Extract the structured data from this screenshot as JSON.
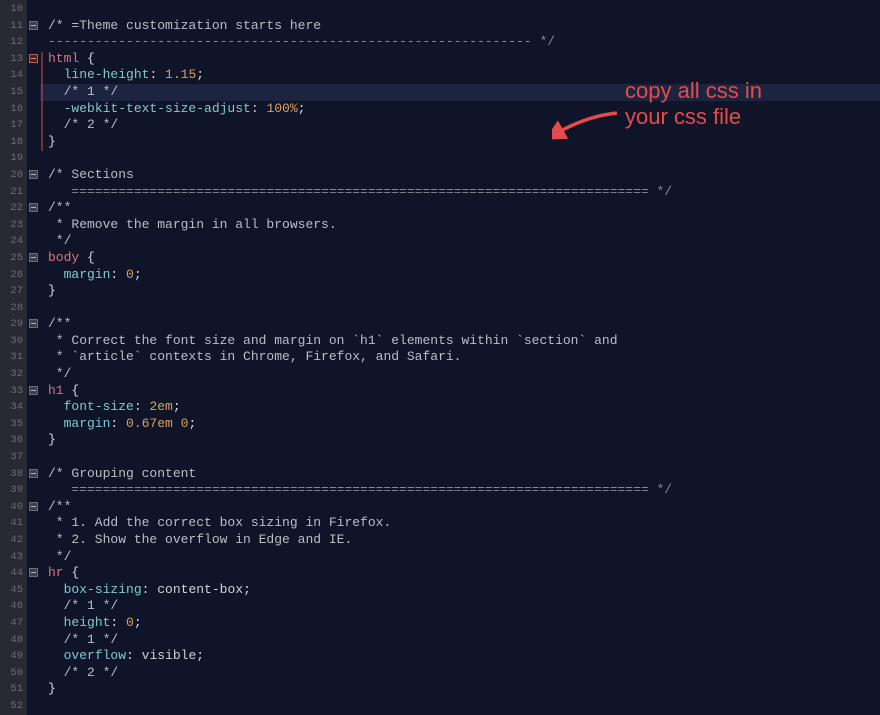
{
  "annotation": {
    "line1": "copy all css in",
    "line2": "your css file"
  },
  "lines": [
    {
      "n": 10
    },
    {
      "n": 11,
      "fold": true,
      "tokens": [
        [
          "comment",
          "/* =Theme customization starts here"
        ]
      ]
    },
    {
      "n": 12,
      "tokens": [
        [
          "faint",
          "-------------------------------------------------------------- */"
        ]
      ]
    },
    {
      "n": 13,
      "fold": "red",
      "tokens": [
        [
          "selector",
          "html"
        ],
        [
          "punct",
          " "
        ],
        [
          "brace",
          "{"
        ]
      ]
    },
    {
      "n": 14,
      "tokens": [
        [
          "pad",
          "  "
        ],
        [
          "prop",
          "line-height"
        ],
        [
          "punct",
          ": "
        ],
        [
          "num",
          "1.15"
        ],
        [
          "punct",
          ";"
        ]
      ]
    },
    {
      "n": 15,
      "hl": true,
      "tokens": [
        [
          "pad",
          "  "
        ],
        [
          "comment",
          "/* 1 */"
        ]
      ]
    },
    {
      "n": 16,
      "tokens": [
        [
          "pad",
          "  "
        ],
        [
          "prop",
          "-webkit-text-size-adjust"
        ],
        [
          "punct",
          ": "
        ],
        [
          "num",
          "100%"
        ],
        [
          "punct",
          ";"
        ]
      ]
    },
    {
      "n": 17,
      "tokens": [
        [
          "pad",
          "  "
        ],
        [
          "comment",
          "/* 2 */"
        ]
      ]
    },
    {
      "n": 18,
      "tokens": [
        [
          "brace",
          "}"
        ]
      ]
    },
    {
      "n": 19
    },
    {
      "n": 20,
      "fold": true,
      "tokens": [
        [
          "comment",
          "/* Sections"
        ]
      ]
    },
    {
      "n": 21,
      "tokens": [
        [
          "pad",
          "   "
        ],
        [
          "faint",
          "========================================================================== */"
        ]
      ]
    },
    {
      "n": 22,
      "fold": true,
      "tokens": [
        [
          "comment",
          "/**"
        ]
      ]
    },
    {
      "n": 23,
      "tokens": [
        [
          "comment",
          " * Remove the margin in all browsers."
        ]
      ]
    },
    {
      "n": 24,
      "tokens": [
        [
          "comment",
          " */"
        ]
      ]
    },
    {
      "n": 25,
      "fold": true,
      "tokens": [
        [
          "selector",
          "body"
        ],
        [
          "punct",
          " "
        ],
        [
          "brace",
          "{"
        ]
      ]
    },
    {
      "n": 26,
      "tokens": [
        [
          "pad",
          "  "
        ],
        [
          "prop",
          "margin"
        ],
        [
          "punct",
          ": "
        ],
        [
          "num",
          "0"
        ],
        [
          "punct",
          ";"
        ]
      ]
    },
    {
      "n": 27,
      "tokens": [
        [
          "brace",
          "}"
        ]
      ]
    },
    {
      "n": 28
    },
    {
      "n": 29,
      "fold": true,
      "tokens": [
        [
          "comment",
          "/**"
        ]
      ]
    },
    {
      "n": 30,
      "tokens": [
        [
          "comment",
          " * Correct the font size and margin on `h1` elements within `section` and"
        ]
      ]
    },
    {
      "n": 31,
      "tokens": [
        [
          "comment",
          " * `article` contexts in Chrome, Firefox, and Safari."
        ]
      ]
    },
    {
      "n": 32,
      "tokens": [
        [
          "comment",
          " */"
        ]
      ]
    },
    {
      "n": 33,
      "fold": true,
      "tokens": [
        [
          "selector",
          "h1"
        ],
        [
          "punct",
          " "
        ],
        [
          "brace",
          "{"
        ]
      ]
    },
    {
      "n": 34,
      "tokens": [
        [
          "pad",
          "  "
        ],
        [
          "prop",
          "font-size"
        ],
        [
          "punct",
          ": "
        ],
        [
          "num",
          "2em"
        ],
        [
          "punct",
          ";"
        ]
      ]
    },
    {
      "n": 35,
      "tokens": [
        [
          "pad",
          "  "
        ],
        [
          "prop",
          "margin"
        ],
        [
          "punct",
          ": "
        ],
        [
          "num",
          "0.67em 0"
        ],
        [
          "punct",
          ";"
        ]
      ]
    },
    {
      "n": 36,
      "tokens": [
        [
          "brace",
          "}"
        ]
      ]
    },
    {
      "n": 37
    },
    {
      "n": 38,
      "fold": true,
      "tokens": [
        [
          "comment",
          "/* Grouping content"
        ]
      ]
    },
    {
      "n": 39,
      "tokens": [
        [
          "pad",
          "   "
        ],
        [
          "faint",
          "========================================================================== */"
        ]
      ]
    },
    {
      "n": 40,
      "fold": true,
      "tokens": [
        [
          "comment",
          "/**"
        ]
      ]
    },
    {
      "n": 41,
      "tokens": [
        [
          "comment",
          " * 1. Add the correct box sizing in Firefox."
        ]
      ]
    },
    {
      "n": 42,
      "tokens": [
        [
          "comment",
          " * 2. Show the overflow in Edge and IE."
        ]
      ]
    },
    {
      "n": 43,
      "tokens": [
        [
          "comment",
          " */"
        ]
      ]
    },
    {
      "n": 44,
      "fold": true,
      "tokens": [
        [
          "selector",
          "hr"
        ],
        [
          "punct",
          " "
        ],
        [
          "brace",
          "{"
        ]
      ]
    },
    {
      "n": 45,
      "tokens": [
        [
          "pad",
          "  "
        ],
        [
          "prop",
          "box-sizing"
        ],
        [
          "punct",
          ": "
        ],
        [
          "ident",
          "content-box"
        ],
        [
          "punct",
          ";"
        ]
      ]
    },
    {
      "n": 46,
      "tokens": [
        [
          "pad",
          "  "
        ],
        [
          "comment",
          "/* 1 */"
        ]
      ]
    },
    {
      "n": 47,
      "tokens": [
        [
          "pad",
          "  "
        ],
        [
          "prop",
          "height"
        ],
        [
          "punct",
          ": "
        ],
        [
          "num",
          "0"
        ],
        [
          "punct",
          ";"
        ]
      ]
    },
    {
      "n": 48,
      "tokens": [
        [
          "pad",
          "  "
        ],
        [
          "comment",
          "/* 1 */"
        ]
      ]
    },
    {
      "n": 49,
      "tokens": [
        [
          "pad",
          "  "
        ],
        [
          "prop",
          "overflow"
        ],
        [
          "punct",
          ": "
        ],
        [
          "ident",
          "visible"
        ],
        [
          "punct",
          ";"
        ]
      ]
    },
    {
      "n": 50,
      "tokens": [
        [
          "pad",
          "  "
        ],
        [
          "comment",
          "/* 2 */"
        ]
      ]
    },
    {
      "n": 51,
      "tokens": [
        [
          "brace",
          "}"
        ]
      ]
    },
    {
      "n": 52
    }
  ]
}
